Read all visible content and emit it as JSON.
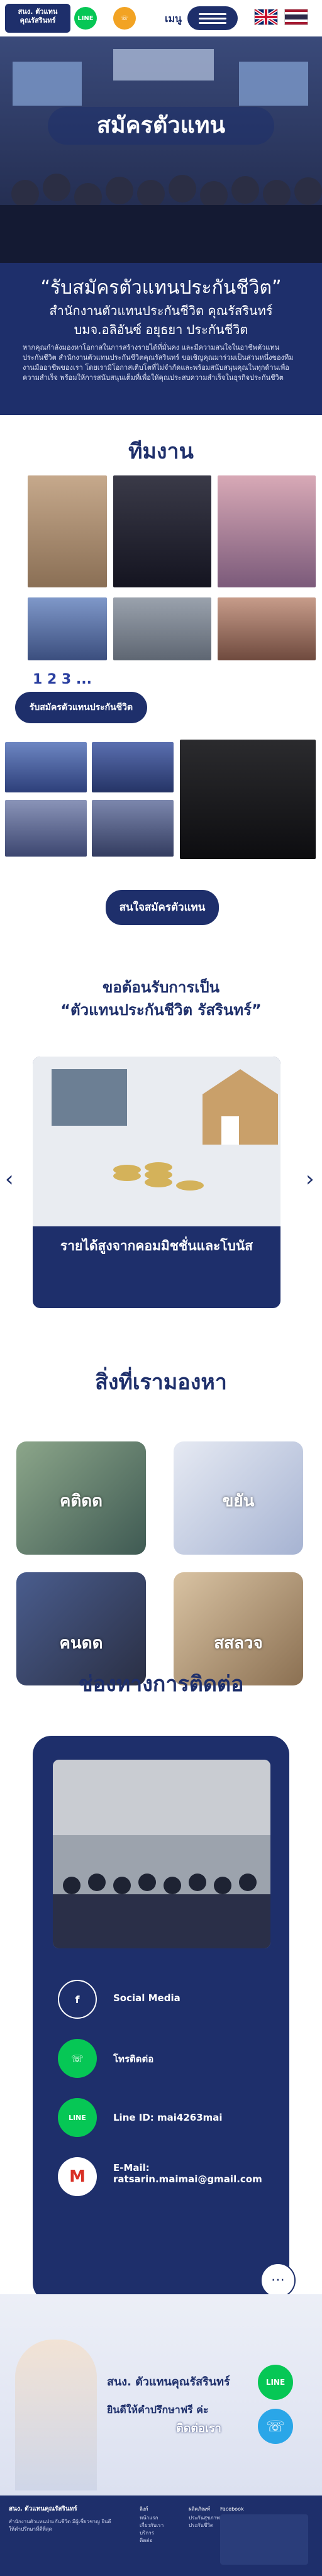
{
  "header": {
    "logo_text": "สนง. ตัวแทน\nคุณรัสรินทร์",
    "line_icon": "line-icon",
    "call_icon": "phone-icon",
    "menu_label": "เมนู",
    "flags": [
      "uk-flag",
      "thai-flag"
    ]
  },
  "hero": {
    "title": "สมัครตัวแทน",
    "quote": "“รับสมัครตัวแทนประกันชีวิต”",
    "line1": "สำนักงานตัวแทนประกันชีวิต คุณรัสรินทร์",
    "line2": "บมจ.อลิอันซ์ อยุธยา ประกันชีวิต",
    "body": "หากคุณกำลังมองหาโอกาสในการสร้างรายได้ที่มั่นคง และมีความสนใจในอาชีพตัวแทนประกันชีวิต สำนักงานตัวแทนประกันชีวิตคุณรัสรินทร์ ขอเชิญคุณมาร่วมเป็นส่วนหนึ่งของทีมงานมืออาชีพของเรา โดยเรามีโอกาสเติบโตที่ไม่จำกัดและพร้อมสนับสนุนคุณในทุกด้านเพื่อความสำเร็จ พร้อมให้การสนับสนุนเต็มที่เพื่อให้คุณประสบความสำเร็จในธุรกิจประกันชีวิต"
  },
  "team": {
    "title": "ทีมงาน",
    "pager": "1 2 3 ...",
    "apply_label": "รับสมัครตัวแทนประกันชีวิต",
    "agent_button": "สนใจสมัครตัวแทน"
  },
  "invite": {
    "line1": "ขอต้อนรับการเป็น",
    "line2": "“ตัวแทนประกันชีวิต รัสรินทร์”",
    "carousel_caption": "รายได้สูงจากคอมมิชชั่นและโบนัส",
    "prev": "‹",
    "next": "›"
  },
  "seeking": {
    "title": "สิ่งที่เรามองหา",
    "items": [
      "คติดด",
      "ขยัน",
      "คนดด",
      "สสลวจ"
    ]
  },
  "contact": {
    "title": "ช่องทางการติดต่อ",
    "items": [
      {
        "icon": "facebook-icon",
        "label": "Social Media"
      },
      {
        "icon": "phone-icon",
        "label": "โทรติดต่อ"
      },
      {
        "icon": "line-icon",
        "label": "Line ID: mai4263mai"
      },
      {
        "icon": "gmail-icon",
        "label": "E-Mail:\nratsarin.maimai@gmail.com"
      }
    ],
    "chat_icon": "chat-bubble-icon"
  },
  "footer_band": {
    "title": "สนง. ตัวแทนคุณรัสรินทร์",
    "subtitle": "ยินดีให้คำปรึกษาฟรี ค่ะ",
    "cta": "ติดต่อเรา",
    "line_icon": "line-icon",
    "call_icon": "phone-icon"
  },
  "footer": {
    "brand": "สนง. ตัวแทนคุณรัสรินทร์",
    "about": "สำนักงานตัวแทนประกันชีวิต มีผู้เชี่ยวชาญ ยินดีให้คำปรึกษาที่ดีที่สุด",
    "menu_head": "ลิงก์",
    "menu_items": [
      "หน้าแรก",
      "เกี่ยวกับเรา",
      "บริการ",
      "ติดต่อ"
    ],
    "col3_head": "ผลิตภัณฑ์",
    "col3_items": [
      "ประกันสุขภาพ",
      "ประกันชีวิต"
    ],
    "col4_head": "Facebook"
  },
  "colors": {
    "navy": "#1e2f6b",
    "line_green": "#06c755",
    "orange": "#f2a323",
    "light_band": "#eceff7"
  }
}
